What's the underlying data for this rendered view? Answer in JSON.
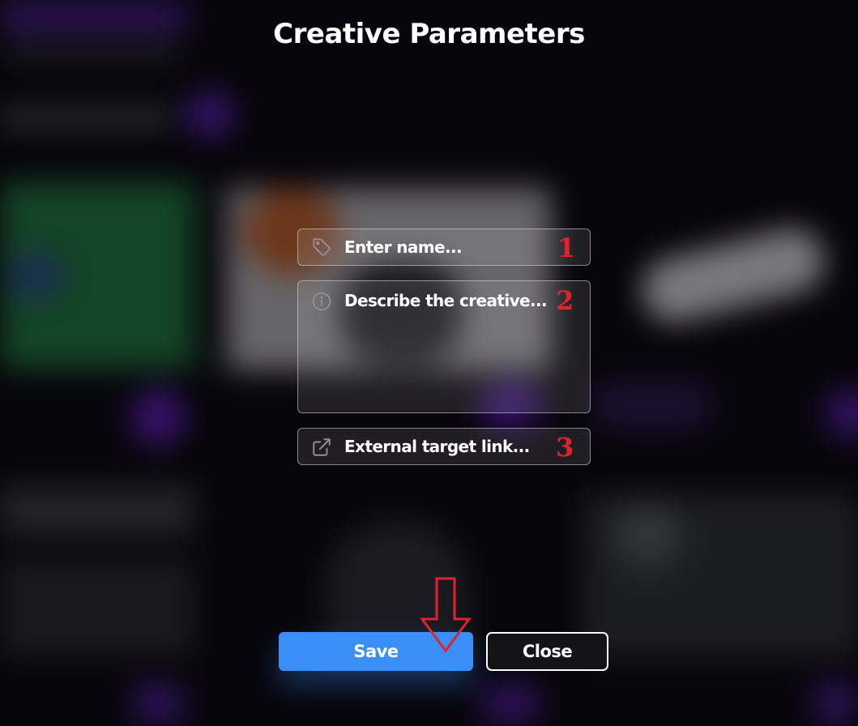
{
  "dialog": {
    "title": "Creative Parameters"
  },
  "form": {
    "name_field": {
      "placeholder": "Enter name...",
      "icon": "tag-icon",
      "marker": "1"
    },
    "description_field": {
      "placeholder": "Describe the creative...",
      "icon": "info-icon",
      "marker": "2"
    },
    "link_field": {
      "placeholder": "External target link...",
      "icon": "external-link-icon",
      "marker": "3"
    }
  },
  "buttons": {
    "save_label": "Save",
    "close_label": "Close"
  },
  "annotation": {
    "arrow_color": "#e0232a",
    "marker_color": "#e0232a"
  },
  "colors": {
    "accent": "#3a8ef5"
  }
}
